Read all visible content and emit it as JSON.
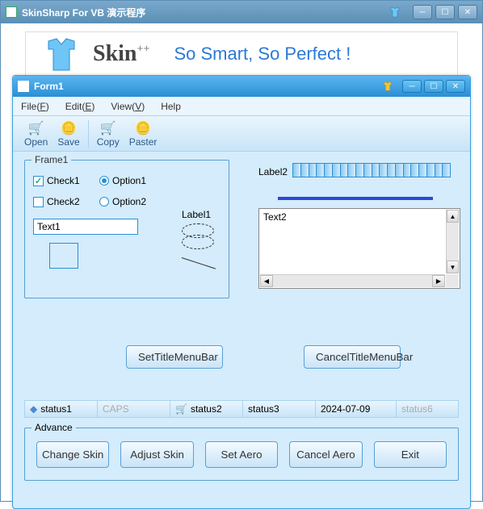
{
  "outer": {
    "title": "SkinSharp For VB 演示程序"
  },
  "banner": {
    "brand_prefix": "Skin",
    "brand_suffix": "++",
    "slogan": "So Smart, So Perfect !"
  },
  "inner": {
    "title": "Form1"
  },
  "menu": {
    "file": "File(",
    "file_u": "F",
    "file_end": ")",
    "edit": "Edit(",
    "edit_u": "E",
    "edit_end": ")",
    "view": "View(",
    "view_u": "V",
    "view_end": ")",
    "help": "Help"
  },
  "toolbar": {
    "open": "Open",
    "save": "Save",
    "copy": "Copy",
    "paste": "Paster"
  },
  "frame": {
    "legend": "Frame1",
    "check1": "Check1",
    "check1_checked": true,
    "check2": "Check2",
    "check2_checked": false,
    "option1": "Option1",
    "option1_sel": true,
    "option2": "Option2",
    "option2_sel": false,
    "text1": "Text1",
    "label1": "Label1"
  },
  "right": {
    "label2": "Label2",
    "text2": "Text2"
  },
  "midbtns": {
    "set": "SetTitleMenuBar",
    "cancel": "CancelTitleMenuBar"
  },
  "status": {
    "s1": "status1",
    "caps": "CAPS",
    "s2": "status2",
    "s3": "status3",
    "date": "2024-07-09",
    "s6": "status6"
  },
  "advance": {
    "legend": "Advance",
    "change": "Change Skin",
    "adjust": "Adjust Skin",
    "setaero": "Set Aero",
    "cancelaero": "Cancel Aero",
    "exit": "Exit"
  }
}
